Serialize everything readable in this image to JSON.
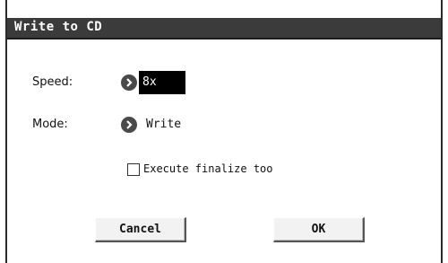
{
  "dialog": {
    "title": "Write to CD",
    "speed": {
      "label": "Speed:",
      "value": "8x"
    },
    "mode": {
      "label": "Mode:",
      "value": "Write"
    },
    "finalize": {
      "label": "Execute finalize too",
      "checked": false
    },
    "buttons": {
      "cancel": "Cancel",
      "ok": "OK"
    }
  },
  "icons": {
    "speed_arrow": "chevron-right-icon",
    "mode_arrow": "chevron-right-icon"
  }
}
